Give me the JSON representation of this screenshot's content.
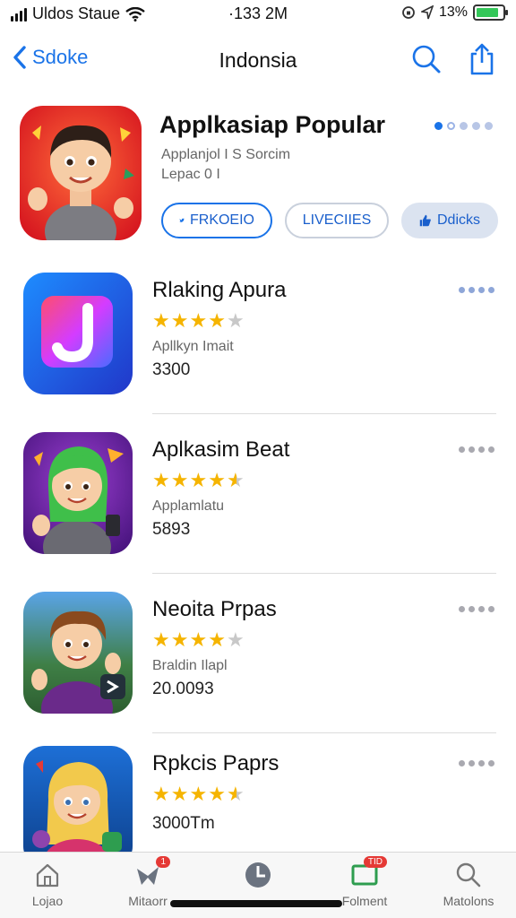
{
  "status_bar": {
    "carrier": "Uldos Staue",
    "time": "·133 2M",
    "battery_text": "13%",
    "battery_level": 0.85,
    "battery_color": "#34c759"
  },
  "nav": {
    "back_label": "Sdoke",
    "title": "Indonsia",
    "search_icon": "search-icon",
    "share_icon": "share-icon"
  },
  "featured": {
    "title": "Applkasiap Popular",
    "sub_line1": "Applanjol I S Sorcim",
    "sub_line2": "Lepac 0 I",
    "buttons": [
      {
        "label": "FRKOEIO",
        "icon": "twitter-bird-icon"
      },
      {
        "label": "LIVECIIES"
      },
      {
        "label": "Ddicks",
        "icon": "thumbs-up-icon"
      }
    ],
    "accent": "#1a73e8"
  },
  "apps": [
    {
      "name": "Rlaking Apura",
      "rating": 4.0,
      "subtitle": "Apllkyn Imait",
      "count": "3300"
    },
    {
      "name": "Aplkasim Beat",
      "rating": 4.5,
      "subtitle": "Applamlatu",
      "count": "5893"
    },
    {
      "name": "Neoita Prpas",
      "rating": 4.0,
      "subtitle": "Braldin Ilapl",
      "count": "20.0093"
    },
    {
      "name": "Rpkcis Paprs",
      "rating": 4.5,
      "subtitle": "",
      "count": "3000Tm"
    }
  ],
  "tabbar": {
    "tabs": [
      {
        "label": "Lojao",
        "icon": "house-icon"
      },
      {
        "label": "Mitaorr",
        "icon": "bird-icon",
        "badge": "1"
      },
      {
        "label": "",
        "icon": "clock-icon"
      },
      {
        "label": "Folment",
        "icon": "screen-icon",
        "badge": "TID"
      },
      {
        "label": "Matolons",
        "icon": "search-icon"
      }
    ]
  }
}
